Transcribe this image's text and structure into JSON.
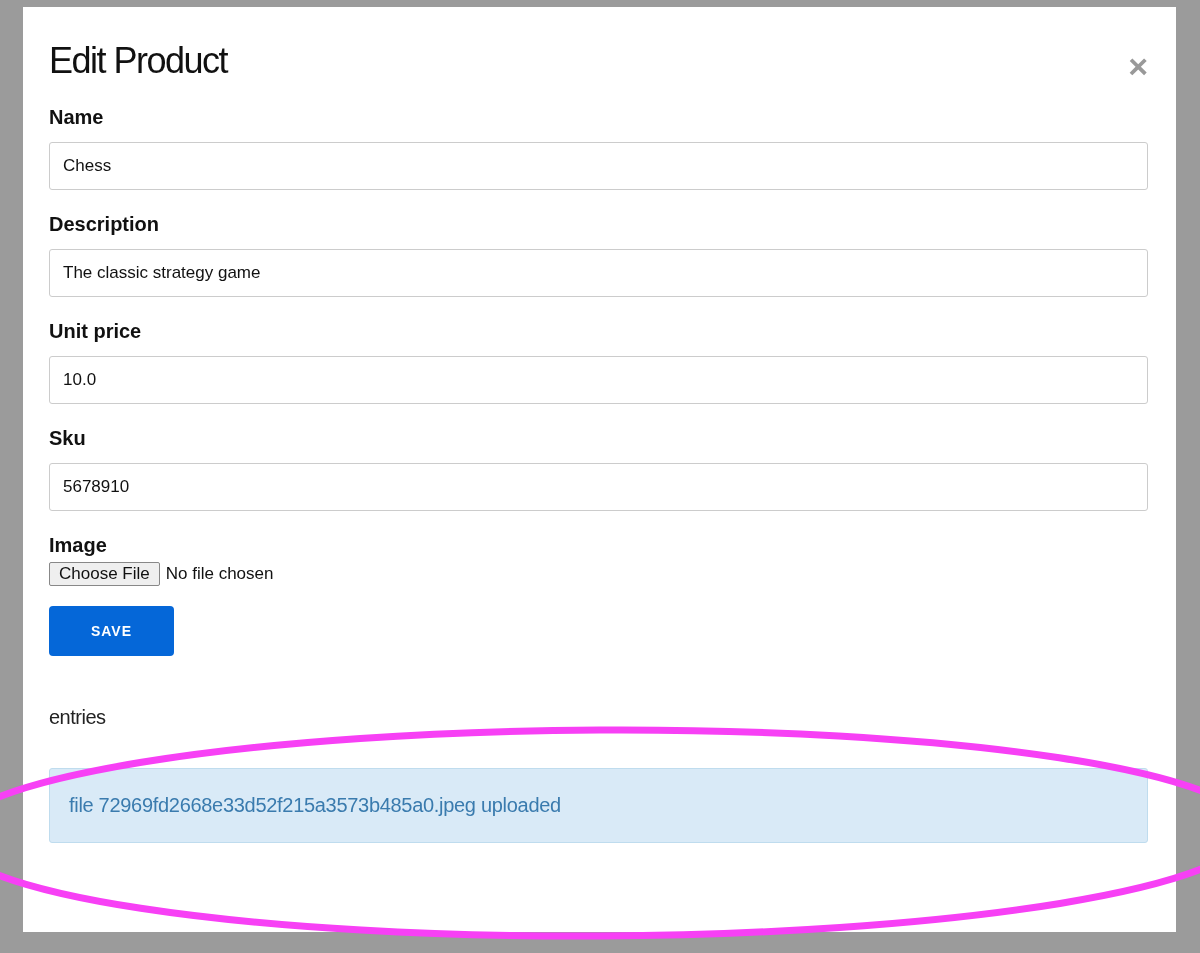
{
  "modal": {
    "title": "Edit Product",
    "close": "×"
  },
  "fields": [
    {
      "label": "Name",
      "value": "Chess"
    },
    {
      "label": "Description",
      "value": "The classic strategy game"
    },
    {
      "label": "Unit price",
      "value": "10.0"
    },
    {
      "label": "Sku",
      "value": "5678910"
    }
  ],
  "image": {
    "label": "Image",
    "button": "Choose File",
    "status": "No file chosen"
  },
  "save_button": "SAVE",
  "entries_label": "entries",
  "alert": "file 72969fd2668e33d52f215a3573b485a0.jpeg uploaded"
}
